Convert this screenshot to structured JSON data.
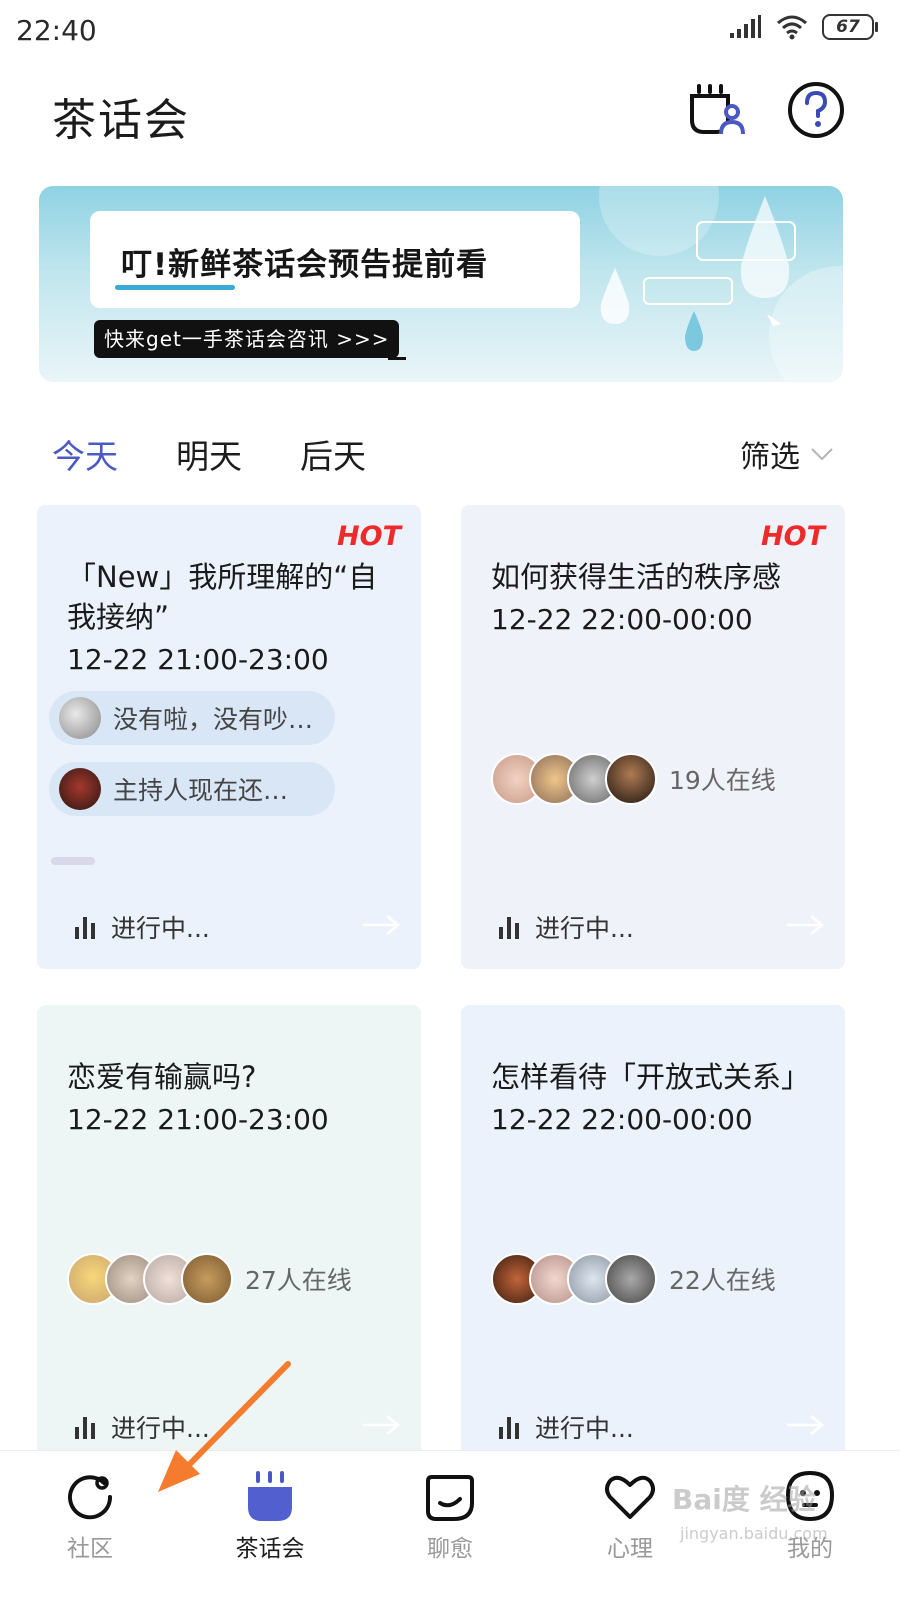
{
  "status_bar": {
    "time": "22:40",
    "battery": "67"
  },
  "header": {
    "title": "茶话会"
  },
  "banner": {
    "title": "叮!新鲜茶话会预告提前看",
    "subtitle": "快来get一手茶话会咨讯 >>>"
  },
  "day_tabs": [
    {
      "label": "今天",
      "active": true
    },
    {
      "label": "明天",
      "active": false
    },
    {
      "label": "后天",
      "active": false
    }
  ],
  "filter_label": "筛选",
  "cards": [
    {
      "hot": "HOT",
      "title": "「New」我所理解的“自我接纳”",
      "time": "12-22 21:00-23:00",
      "messages": [
        "没有啦，没有吵…",
        "主持人现在还…"
      ],
      "status": "进行中..."
    },
    {
      "hot": "HOT",
      "title": "如何获得生活的秩序感",
      "time": "12-22 22:00-00:00",
      "online": "19人在线",
      "status": "进行中..."
    },
    {
      "title": "恋爱有输赢吗?",
      "time": "12-22 21:00-23:00",
      "online": "27人在线",
      "status": "进行中..."
    },
    {
      "title": "怎样看待「开放式关系」",
      "time": "12-22 22:00-00:00",
      "online": "22人在线",
      "status": "进行中..."
    }
  ],
  "bottom_nav": [
    {
      "label": "社区",
      "icon": "community-icon",
      "active": false
    },
    {
      "label": "茶话会",
      "icon": "tea-party-icon",
      "active": true
    },
    {
      "label": "聊愈",
      "icon": "chat-heal-icon",
      "active": false
    },
    {
      "label": "心理",
      "icon": "heart-icon",
      "active": false
    },
    {
      "label": "我的",
      "icon": "profile-face-icon",
      "active": false
    }
  ],
  "watermark": {
    "main": "Bai度 经验",
    "sub": "jingyan.baidu.com"
  },
  "colors": {
    "accent": "#4b59c5",
    "hot": "#ee2a2a",
    "annotation_arrow": "#f57c2e"
  }
}
